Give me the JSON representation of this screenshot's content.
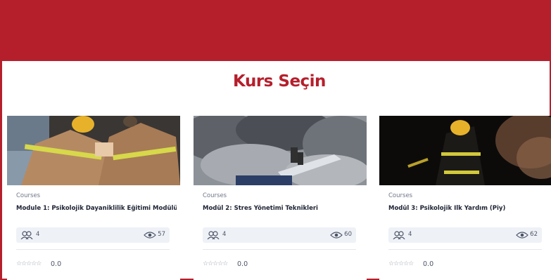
{
  "page": {
    "title": "Kurs Seçin"
  },
  "colors": {
    "brand": "#b51f2c",
    "meta_bar": "#eef1f6"
  },
  "courses": [
    {
      "category": "Courses",
      "title": "Module 1: Psikolojik Dayaniklilik Eğitimi Modülü",
      "students": "4",
      "views": "57",
      "stars": "☆☆☆☆☆",
      "rating": "0.0",
      "student_icon": "students-icon",
      "view_icon": "eye-icon"
    },
    {
      "category": "Courses",
      "title": "Modül 2: Stres Yönetimi Teknikleri",
      "students": "4",
      "views": "60",
      "stars": "☆☆☆☆☆",
      "rating": "0.0",
      "student_icon": "students-icon",
      "view_icon": "eye-icon"
    },
    {
      "category": "Courses",
      "title": "Modül 3: Psikolojik İlk Yardım (Piy)",
      "students": "4",
      "views": "62",
      "stars": "☆☆☆☆☆",
      "rating": "0.0",
      "student_icon": "students-icon",
      "view_icon": "eye-icon"
    }
  ]
}
